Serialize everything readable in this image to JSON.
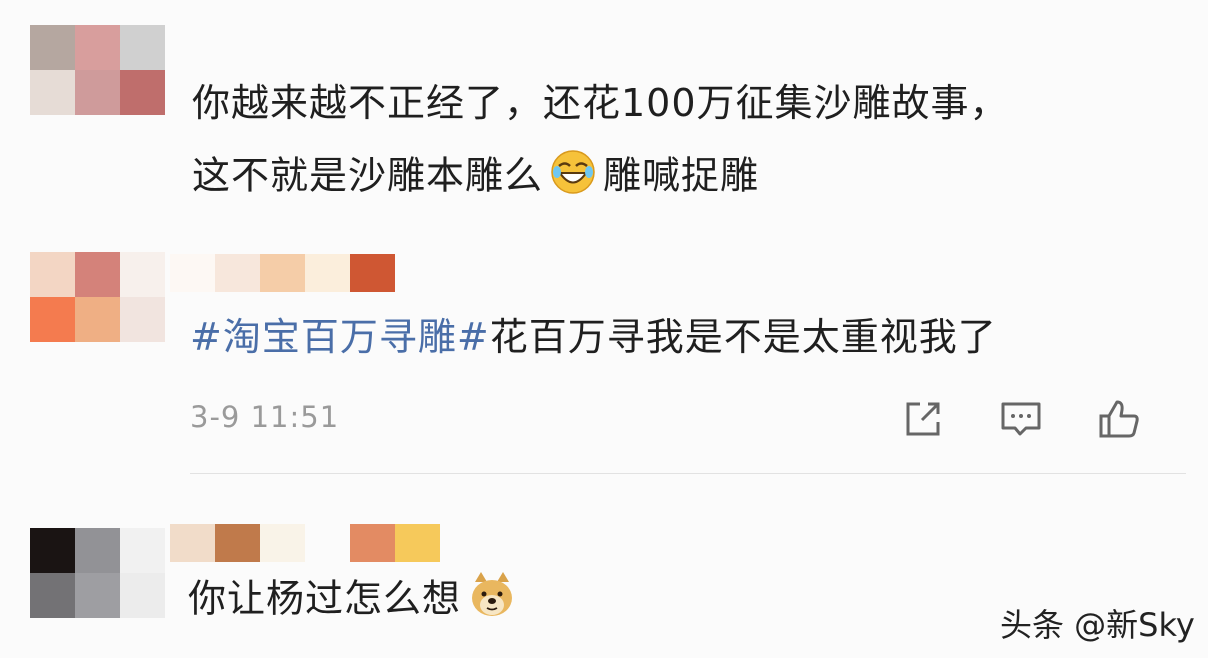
{
  "comments": [
    {
      "text_lines": [
        "你越来越不正经了，还花100万征集沙雕故事，",
        "这不就是沙雕本雕么"
      ],
      "emoji": "laughing-tears-icon",
      "suffix": "雕喊捉雕",
      "avatar_colors": [
        "#b5a7a0",
        "#d89e9d",
        "#d0d0d0",
        "#e6dcd6",
        "#cf9b9b",
        "#bf6e6c"
      ]
    },
    {
      "topic": "#淘宝百万寻雕#",
      "text": "花百万寻我是不是太重视我了",
      "timestamp": "3-9 11:51",
      "avatar_colors": [
        "#f3d6c4",
        "#d4827a",
        "#f7f0ec",
        "#f47b4f",
        "#efaf84",
        "#f1e4df"
      ],
      "name_colors": [
        "#fdf8f4",
        "#f7e7dc",
        "#f5cda8",
        "#fbeedc",
        "#cf5733"
      ],
      "actions": [
        "share-icon",
        "comment-icon",
        "like-icon"
      ]
    },
    {
      "text": "你让杨过怎么想",
      "emoji": "doge-icon",
      "avatar_colors": [
        "#1a1413",
        "#929296",
        "#f1f1f1",
        "#737275",
        "#9e9ea2",
        "#ececec"
      ],
      "name_colors": [
        "#f1dcc9",
        "#c07a4b",
        "#f9f3e8",
        "#fbfbfb",
        "#e38b63",
        "#f6c95b"
      ]
    }
  ],
  "watermark": "头条 @新Sky"
}
